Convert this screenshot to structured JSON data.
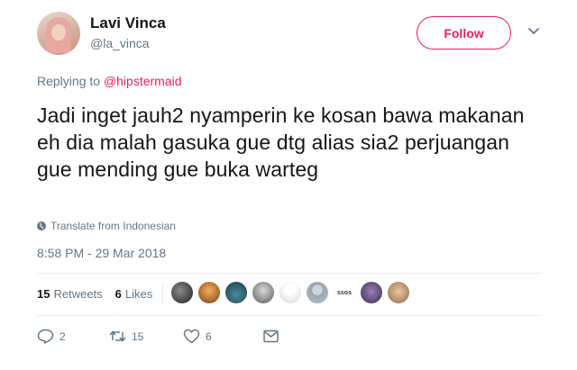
{
  "user": {
    "name": "Lavi Vinca",
    "handle": "@la_vinca"
  },
  "follow_label": "Follow",
  "reply_context": {
    "prefix": "Replying to",
    "mention": "@hipstermaid"
  },
  "tweet_text": "Jadi inget jauh2 nyamperin ke kosan bawa makanan eh dia malah gasuka gue dtg alias sia2 perjuangan gue mending gue buka warteg",
  "translate_label": "Translate from Indonesian",
  "timestamp": "8:58 PM - 29 Mar 2018",
  "stats": {
    "retweets_count": "15",
    "retweets_label": "Retweets",
    "likes_count": "6",
    "likes_label": "Likes"
  },
  "likers_text_badge": "ssos",
  "actions": {
    "reply_count": "2",
    "retweet_count": "15",
    "like_count": "6"
  },
  "colors": {
    "accent": "#e0245e",
    "muted": "#657786",
    "text": "#14171a",
    "border": "#e6ecf0"
  },
  "icons": [
    "chevron-down-icon",
    "globe-icon",
    "reply-icon",
    "retweet-icon",
    "heart-icon",
    "message-icon"
  ]
}
